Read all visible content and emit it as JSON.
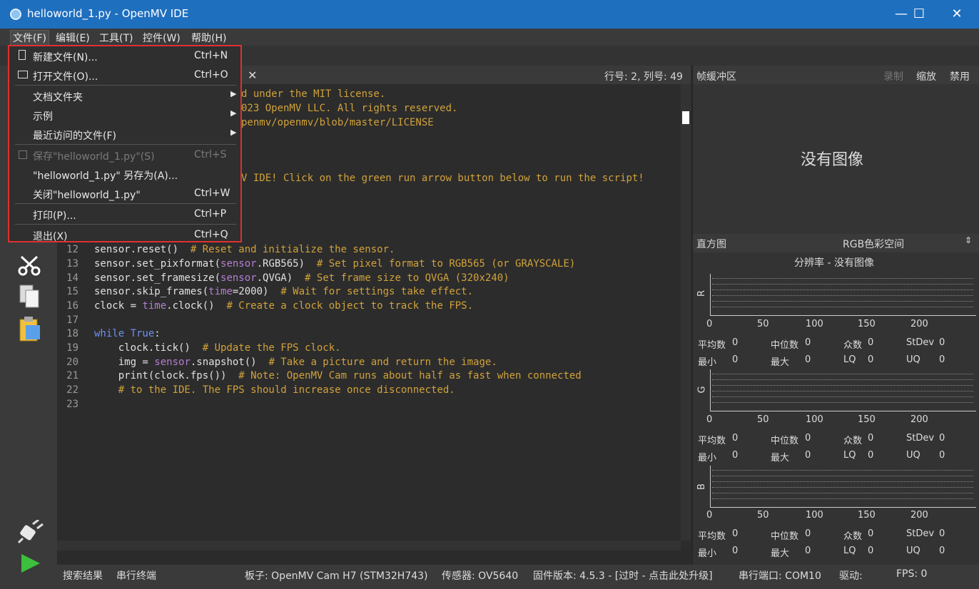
{
  "window": {
    "title": "helloworld_1.py - OpenMV IDE",
    "controls": {
      "minimize": "—",
      "maximize": "☐",
      "close": "✕"
    }
  },
  "menubar": {
    "items": [
      "文件(F)",
      "编辑(E)",
      "工具(T)",
      "控件(W)",
      "帮助(H)"
    ]
  },
  "file_menu": {
    "items": [
      {
        "label": "新建文件(N)...",
        "shortcut": "Ctrl+N"
      },
      {
        "label": "打开文件(O)...",
        "shortcut": "Ctrl+O"
      },
      {
        "label": "文档文件夹",
        "shortcut": ""
      },
      {
        "label": "示例",
        "shortcut": ""
      },
      {
        "label": "最近访问的文件(F)",
        "shortcut": ""
      },
      {
        "label": "保存\"helloworld_1.py\"(S)",
        "shortcut": "Ctrl+S"
      },
      {
        "label": "\"helloworld_1.py\" 另存为(A)...",
        "shortcut": ""
      },
      {
        "label": "关闭\"helloworld_1.py\"",
        "shortcut": "Ctrl+W"
      },
      {
        "label": "打印(P)...",
        "shortcut": "Ctrl+P"
      },
      {
        "label": "退出(X)",
        "shortcut": "Ctrl+Q"
      }
    ]
  },
  "editor": {
    "cursor_pos": "行号: 2, 列号: 49",
    "tab_close": "✕",
    "visible_fragments": [
      "d under the MIT license.",
      "023 OpenMV LLC. All rights reserved.",
      "penmv/openmv/blob/master/LICENSE",
      "V IDE! Click on the green run arrow button below to run the script!"
    ],
    "line_numbers": [
      "12",
      "13",
      "14",
      "15",
      "16",
      "17",
      "18",
      "19",
      "20",
      "21",
      "22",
      "23"
    ]
  },
  "frame_buffer": {
    "title": "帧缓冲区",
    "actions": [
      "录制",
      "缩放",
      "禁用"
    ],
    "no_image": "没有图像"
  },
  "histogram": {
    "title": "直方图",
    "colorspace": "RGB色彩空间",
    "resolution": "分辨率 - 没有图像",
    "ticks": [
      "0",
      "50",
      "100",
      "150",
      "200"
    ],
    "channels": [
      {
        "name": "R",
        "mean": "0",
        "median": "0",
        "mode": "0",
        "stdev": "0",
        "min": "0",
        "max": "0",
        "lq": "0",
        "uq": "0"
      },
      {
        "name": "G",
        "mean": "0",
        "median": "0",
        "mode": "0",
        "stdev": "0",
        "min": "0",
        "max": "0",
        "lq": "0",
        "uq": "0"
      },
      {
        "name": "B",
        "mean": "0",
        "median": "0",
        "mode": "0",
        "stdev": "0",
        "min": "0",
        "max": "0",
        "lq": "0",
        "uq": "0"
      }
    ],
    "stat_labels": {
      "mean": "平均数",
      "median": "中位数",
      "mode": "众数",
      "stdev": "StDev",
      "min": "最小",
      "max": "最大",
      "lq": "LQ",
      "uq": "UQ"
    }
  },
  "statusbar": {
    "search_results": "搜索结果",
    "serial_terminal": "串行终端",
    "board": "板子: OpenMV Cam H7 (STM32H743)",
    "sensor": "传感器: OV5640",
    "firmware": "固件版本: 4.5.3 - [过时 - 点击此处升级]",
    "serial_port": "串行端口: COM10",
    "driver": "驱动:",
    "fps": "FPS: 0"
  },
  "colors": {
    "titlebar": "#1f6fbf",
    "menu_highlight": "#e03030",
    "run_button": "#3cbf3c"
  }
}
